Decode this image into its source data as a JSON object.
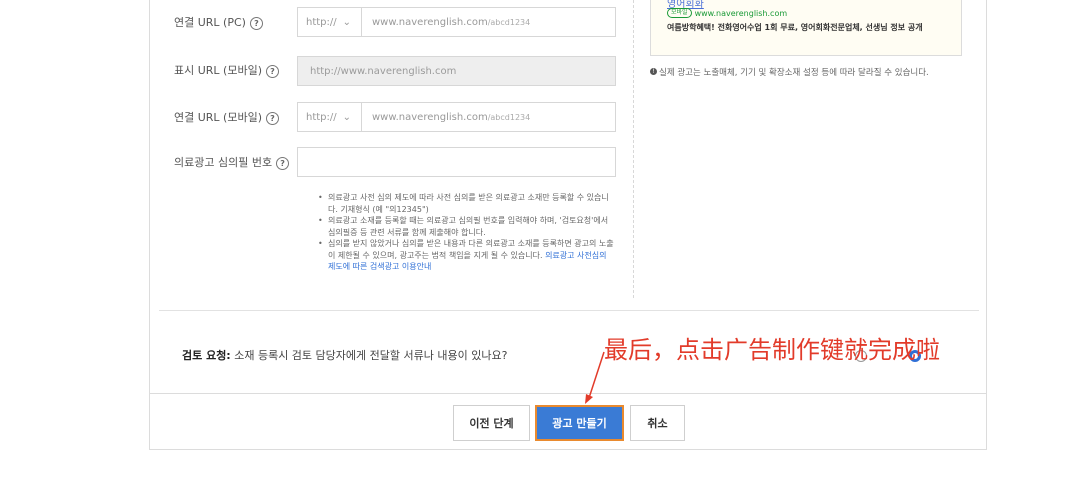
{
  "form": {
    "connect_url_pc": {
      "label": "연결 URL (PC)",
      "protocol": "http://",
      "domain": "www.naverenglish.com",
      "path": "/abcd1234"
    },
    "display_url_mobile": {
      "label": "표시 URL (모바일)",
      "value": "http://www.naverenglish.com"
    },
    "connect_url_mobile": {
      "label": "연결 URL (모바일)",
      "protocol": "http://",
      "domain": "www.naverenglish.com",
      "path": "/abcd1234"
    },
    "medical_review": {
      "label": "의료광고 심의필 번호",
      "value": ""
    },
    "notes": [
      "의료광고 사전 심의 제도에 따라 사전 심의를 받은 의료광고 소재만 등록할 수 있습니다. 기재형식 (예 \"의12345\")",
      "의료광고 소재를 등록할 때는 의료광고 심의필 번호를 입력해야 하며, '검토요청'에서 심의필증 등 관련 서류를 함께 제출해야 합니다.",
      "심의를 받지 않았거나 심의를 받은 내용과 다른 의료광고 소재를 등록하면 광고의 노출이 제한될 수 있으며, 광고주는 법적 책임을 지게 될 수 있습니다."
    ],
    "notes_link": "의료광고 사전심의 제도에 따른 검색광고 이용안내"
  },
  "preview": {
    "title": "영어회화",
    "badge": "모바일",
    "url": "www.naverenglish.com",
    "description": "여름방학혜택! 전화영어수업 1회 무료, 영어회화전문업체, 선생님 정보 공개",
    "note": "실제 광고는 노출매체, 기기 및 확장소재 설정 등에 따라 달라질 수 있습니다."
  },
  "review": {
    "label": "검토 요청:",
    "question": "소재 등록시 검토 담당자에게 전달할 서류나 내용이 있나요?"
  },
  "buttons": {
    "prev": "이전 단계",
    "create": "광고 만들기",
    "cancel": "취소"
  },
  "annotation": {
    "text": "最后，点击广告制作键就完成啦",
    "color": "#e23b2a"
  },
  "colors": {
    "primary": "#3a7bd5",
    "link": "#2f6fd6",
    "highlight_border": "#e98a2f"
  }
}
